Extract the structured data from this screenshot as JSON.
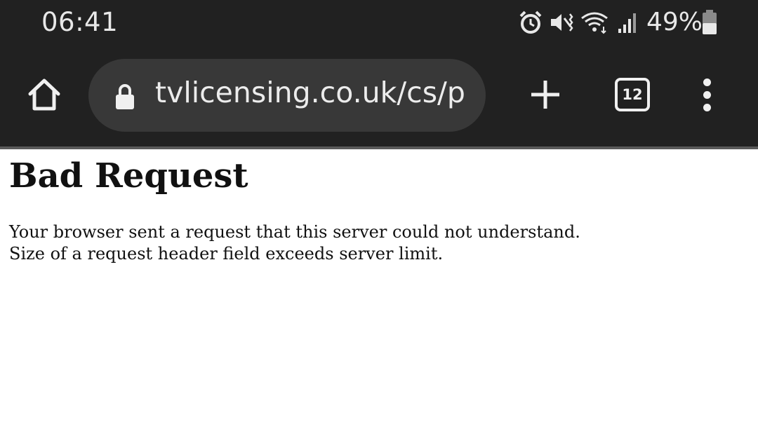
{
  "status_bar": {
    "time": "06:41",
    "battery_percent": "49%",
    "icons": [
      "alarm-icon",
      "vibrate-mute-icon",
      "wifi-icon",
      "signal-icon",
      "battery-icon"
    ]
  },
  "browser": {
    "url": "tvlicensing.co.uk/cs/p",
    "tab_count": "12",
    "icons": [
      "home-icon",
      "lock-icon",
      "plus-icon",
      "overflow-menu-icon"
    ]
  },
  "page": {
    "heading": "Bad Request",
    "message_line1": "Your browser sent a request that this server could not understand.",
    "message_line2": "Size of a request header field exceeds server limit."
  },
  "colors": {
    "chrome_background": "#212121",
    "url_bar_background": "#383838",
    "page_background": "#ffffff",
    "text": "#111111"
  }
}
